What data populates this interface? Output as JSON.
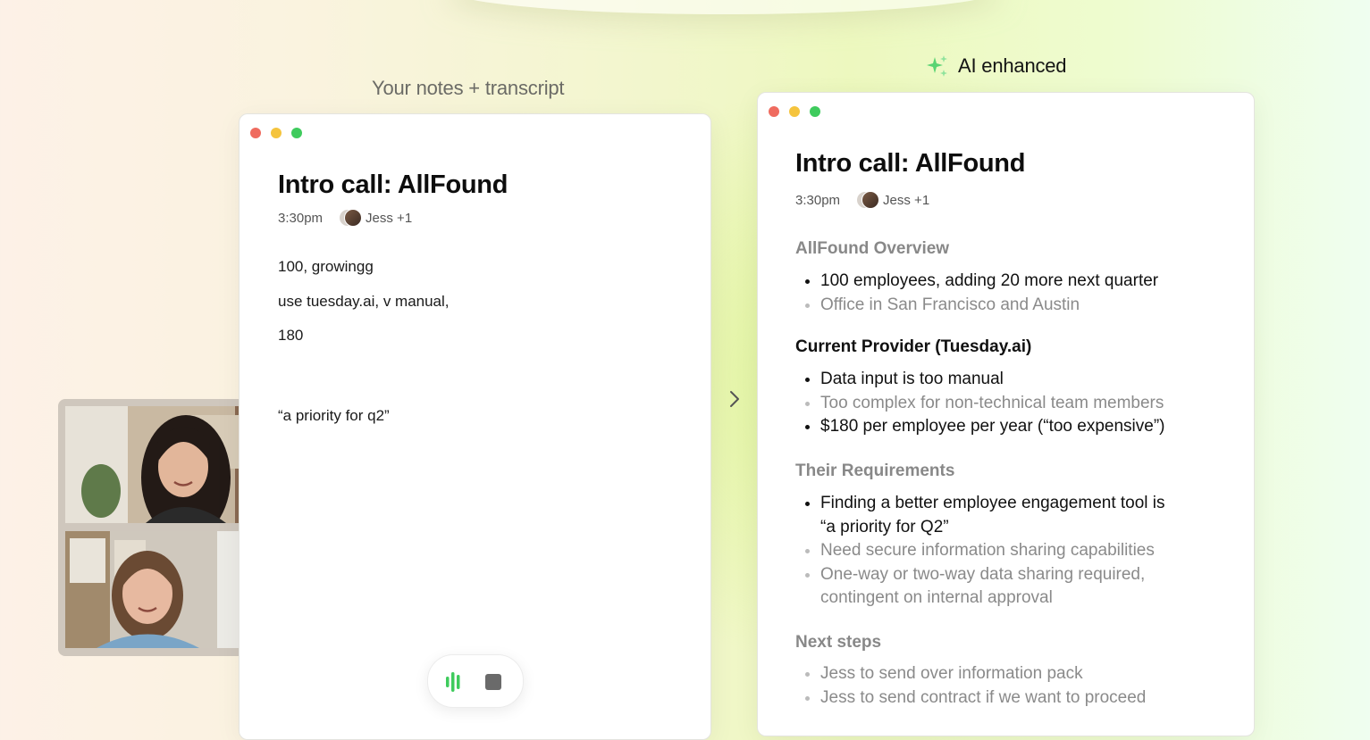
{
  "captions": {
    "left": "Your notes + transcript",
    "right": "AI enhanced"
  },
  "colors": {
    "accent_green": "#3fcb5d",
    "dot_red": "#ef6b5f",
    "dot_yellow": "#f5c43d",
    "dot_green": "#3fcb5d"
  },
  "left_window": {
    "title": "Intro call: AllFound",
    "time": "3:30pm",
    "attendees": "Jess +1",
    "notes": [
      "100, growingg",
      "use tuesday.ai, v manual,",
      "180",
      "“a priority for q2”"
    ]
  },
  "right_window": {
    "title": "Intro call: AllFound",
    "time": "3:30pm",
    "attendees": "Jess +1",
    "sections": [
      {
        "heading": "AllFound Overview",
        "items": [
          {
            "text": "100 employees, adding 20 more next quarter",
            "muted": false
          },
          {
            "text": "Office in San Francisco and Austin",
            "muted": true
          }
        ]
      },
      {
        "heading": "Current Provider (Tuesday.ai)",
        "items": [
          {
            "text": "Data input is too manual",
            "muted": false
          },
          {
            "text": "Too complex for non-technical team members",
            "muted": true
          },
          {
            "text": "$180 per employee per year (“too expensive”)",
            "muted": false
          }
        ]
      },
      {
        "heading": "Their Requirements",
        "items": [
          {
            "text": "Finding a better employee engagement tool is “a priority for Q2”",
            "muted": false
          },
          {
            "text": "Need secure information sharing capabilities",
            "muted": true
          },
          {
            "text": "One-way or two-way data sharing required, contingent on internal approval",
            "muted": true
          }
        ]
      },
      {
        "heading": "Next steps",
        "items": [
          {
            "text": "Jess to send over information pack",
            "muted": true
          },
          {
            "text": "Jess to send contract if we want to proceed",
            "muted": true
          }
        ]
      }
    ]
  },
  "icons": {
    "sparkle": "sparkle-icon",
    "chevron": "chevron-right-icon",
    "recording": "audio-bars-icon",
    "stop": "stop-icon"
  }
}
